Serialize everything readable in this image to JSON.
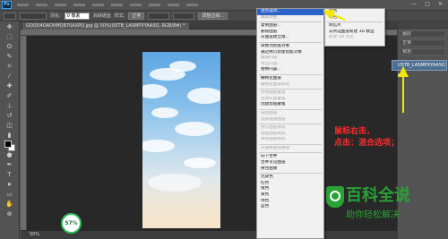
{
  "app": {
    "logo": "Ps"
  },
  "window_controls": {
    "minimize": "—",
    "maximize": "□",
    "close": "✕"
  },
  "options_bar": {
    "feather_label": "羽化:",
    "feather_value": "0 像素",
    "antialias_label": "消除锯齿",
    "style_label": "样式:",
    "style_value": "正常",
    "refine_button": "调整边缘..."
  },
  "document": {
    "tab_title": "GOOD4OAOVMQB70AXPQ.jpg @ 50%(USTB_LASMPXYAASQ, RGB/8#) *"
  },
  "status_bar": {
    "zoom": "50%"
  },
  "badge": {
    "text": "57%"
  },
  "layers_panel": {
    "layer_name": "USTB_LASMPXYAASQ",
    "rows": [
      "图层",
      "正常",
      "锁定:"
    ]
  },
  "context_menu": {
    "items": [
      {
        "label": "混合选项...",
        "state": "highlight"
      },
      {
        "label": "编辑调整...",
        "state": "disabled"
      },
      {
        "sep": true
      },
      {
        "label": "复制图层...",
        "state": "normal"
      },
      {
        "label": "删除图层",
        "state": "normal"
      },
      {
        "label": "从图层建立组...",
        "state": "normal"
      },
      {
        "sep": true
      },
      {
        "label": "转换为智能对象",
        "state": "normal"
      },
      {
        "label": "通过拷贝新建智能对象",
        "state": "normal"
      },
      {
        "label": "编辑内容",
        "state": "disabled"
      },
      {
        "label": "导出内容...",
        "state": "disabled"
      },
      {
        "label": "替换内容...",
        "state": "normal"
      },
      {
        "sep": true
      },
      {
        "label": "栅格化图层",
        "state": "normal"
      },
      {
        "label": "栅格化图层样式",
        "state": "disabled"
      },
      {
        "sep": true
      },
      {
        "label": "停用图层蒙版",
        "state": "disabled"
      },
      {
        "label": "启用矢量蒙版",
        "state": "disabled"
      },
      {
        "label": "创建剪贴蒙版",
        "state": "normal"
      },
      {
        "sep": true
      },
      {
        "label": "链接图层",
        "state": "disabled"
      },
      {
        "label": "选择链接图层",
        "state": "disabled"
      },
      {
        "sep": true
      },
      {
        "label": "拷贝图层样式",
        "state": "disabled"
      },
      {
        "label": "粘贴图层样式",
        "state": "disabled"
      },
      {
        "label": "清除图层样式",
        "state": "disabled"
      },
      {
        "sep": true
      },
      {
        "label": "从隔离图层释放",
        "state": "disabled"
      },
      {
        "sep": true
      },
      {
        "label": "向下合并",
        "state": "normal"
      },
      {
        "label": "合并可见图层",
        "state": "normal"
      },
      {
        "label": "拼合图像",
        "state": "normal"
      },
      {
        "sep": true
      },
      {
        "label": "无颜色",
        "state": "normal"
      },
      {
        "label": "红色",
        "state": "normal"
      },
      {
        "label": "橙色",
        "state": "normal"
      },
      {
        "label": "黄色",
        "state": "normal"
      },
      {
        "label": "绿色",
        "state": "normal"
      },
      {
        "label": "蓝色",
        "state": "normal"
      }
    ]
  },
  "sub_menu": {
    "items": [
      {
        "label": "紫色",
        "state": "normal"
      },
      {
        "label": "灰色",
        "state": "normal"
      },
      {
        "sep": true
      },
      {
        "label": "明信片",
        "state": "normal"
      },
      {
        "label": "从所选图层新建 3D 模型",
        "state": "normal"
      },
      {
        "label": "新建 3D 凸出",
        "state": "disabled"
      }
    ]
  },
  "annotation": {
    "line1": "鼠标右击，",
    "line2": "点击：混合选项；"
  },
  "watermark": {
    "title": "百科全说",
    "subtitle": "助你轻松解决"
  },
  "colors": {
    "highlight": "#2e63c9",
    "annotation": "#ff2a2a",
    "arrow": "#f5e600",
    "watermark": "#2aa236"
  }
}
